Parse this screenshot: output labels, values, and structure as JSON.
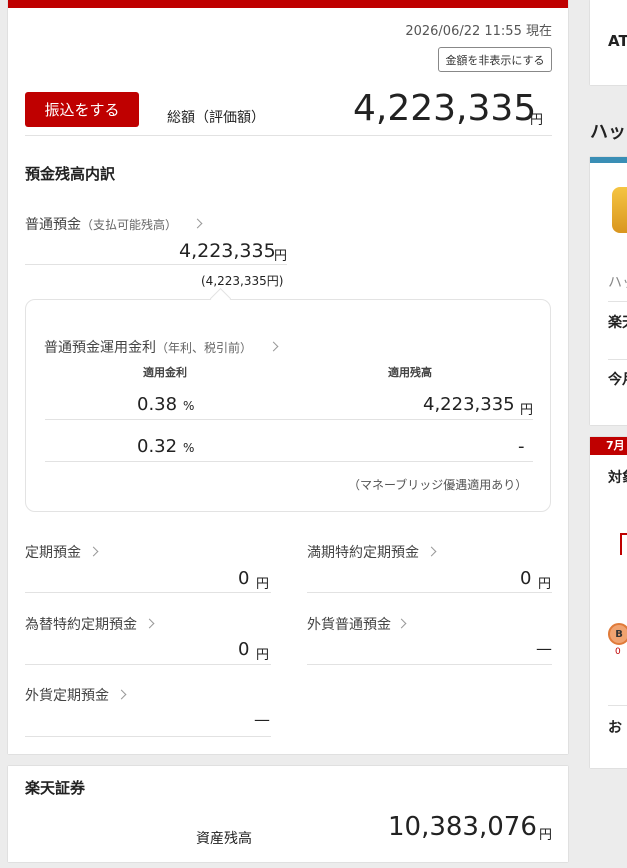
{
  "header": {
    "timestamp": "2026/06/22 11:55 現在",
    "hide_amount_label": "金額を非表示にする"
  },
  "summary": {
    "transfer_label": "振込をする",
    "total_label": "総額（評価額）",
    "total_value": "4,223,335",
    "yen": "円"
  },
  "deposit": {
    "section_title": "預金残高内訳",
    "ordinary": {
      "label": "普通預金",
      "sub_label": "（支払可能残高）",
      "value": "4,223,335",
      "sub_value": "(4,223,335円)"
    },
    "rates": {
      "title": "普通預金運用金利",
      "title_sub": "（年利、税引前）",
      "col_rate": "適用金利",
      "col_balance": "適用残高",
      "rows": [
        {
          "rate": "0.38",
          "pct": "%",
          "balance": "4,223,335",
          "yen": "円"
        },
        {
          "rate": "0.32",
          "pct": "%",
          "balance": "-"
        }
      ],
      "note": "（マネーブリッジ優遇適用あり）"
    },
    "items": [
      {
        "label": "定期預金",
        "value": "0",
        "yen": "円"
      },
      {
        "label": "満期特約定期預金",
        "value": "0",
        "yen": "円"
      },
      {
        "label": "為替特約定期預金",
        "value": "0",
        "yen": "円"
      },
      {
        "label": "外貨普通預金",
        "value": "—"
      },
      {
        "label": "外貨定期預金",
        "value": "—"
      }
    ]
  },
  "securities": {
    "title": "楽天証券",
    "asset_label": "資産残高",
    "value": "10,383,076",
    "yen": "円"
  },
  "right_panel": {
    "card1_text": "AT",
    "heading": "ハッ",
    "card2_lines": [
      "ハッ",
      "楽天",
      "今月"
    ],
    "card3_badge": "7月",
    "card3_text": "対象",
    "card3_small": "0",
    "card3_bottom": "お"
  },
  "colors": {
    "brand_red": "#bf0000",
    "accent_teal": "#3a8eb5"
  }
}
